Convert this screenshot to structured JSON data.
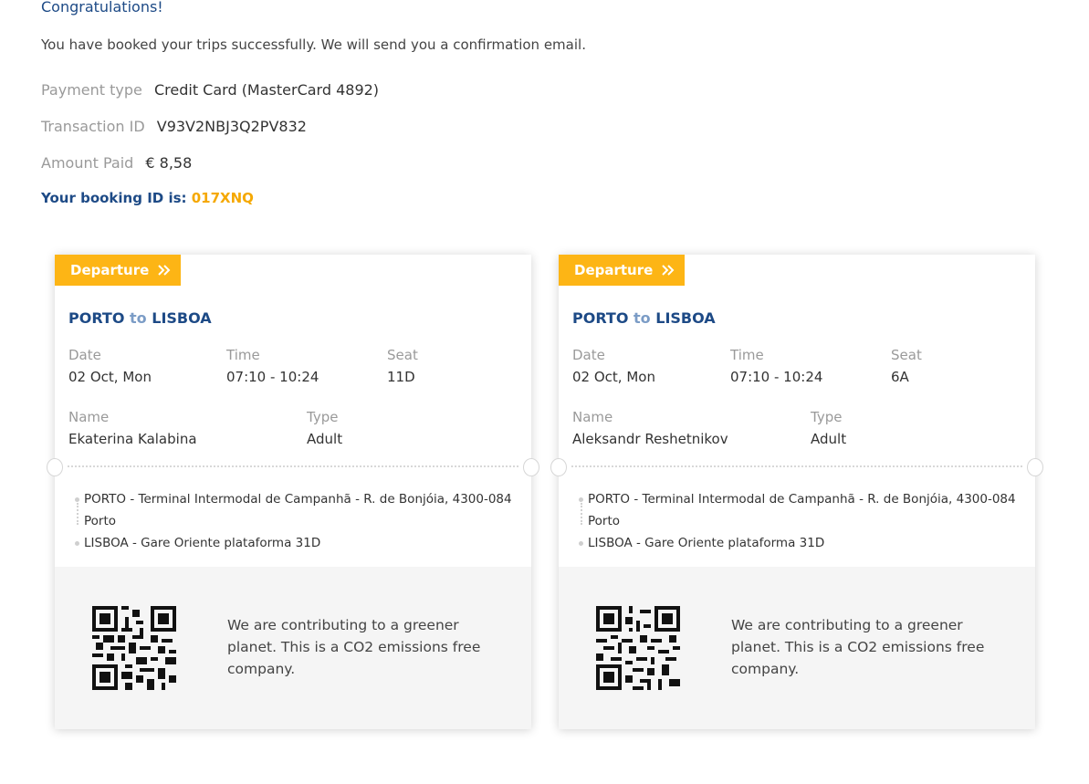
{
  "header": {
    "congrats": "Congratulations!",
    "message": "You have booked your trips successfully. We will send you a confirmation email.",
    "payment_type_label": "Payment type",
    "payment_type_value": "Credit Card (MasterCard 4892)",
    "transaction_label": "Transaction ID",
    "transaction_value": "V93V2NBJ3Q2PV832",
    "amount_label": "Amount Paid",
    "amount_value": "€ 8,58",
    "booking_prefix": "Your booking ID is:",
    "booking_id": "017XNQ"
  },
  "tickets": [
    {
      "badge": "Departure",
      "from": "PORTO",
      "to_word": "to",
      "to": "LISBOA",
      "date_label": "Date",
      "date": "02 Oct, Mon",
      "time_label": "Time",
      "time": "07:10 - 10:24",
      "seat_label": "Seat",
      "seat": "11D",
      "name_label": "Name",
      "name": "Ekaterina Kalabina",
      "type_label": "Type",
      "type": "Adult",
      "origin_stop": "PORTO - Terminal Intermodal de Campanhã - R. de Bonjóia, 4300-084 Porto",
      "dest_stop": "LISBOA - Gare Oriente plataforma 31D",
      "green_text": "We are contributing to a greener planet. This is a CO2 emissions free company."
    },
    {
      "badge": "Departure",
      "from": "PORTO",
      "to_word": "to",
      "to": "LISBOA",
      "date_label": "Date",
      "date": "02 Oct, Mon",
      "time_label": "Time",
      "time": "07:10 - 10:24",
      "seat_label": "Seat",
      "seat": "6A",
      "name_label": "Name",
      "name": "Aleksandr Reshetnikov",
      "type_label": "Type",
      "type": "Adult",
      "origin_stop": "PORTO - Terminal Intermodal de Campanhã - R. de Bonjóia, 4300-084 Porto",
      "dest_stop": "LISBOA - Gare Oriente plataforma 31D",
      "green_text": "We are contributing to a greener planet. This is a CO2 emissions free company."
    }
  ],
  "colors": {
    "navy": "#1d4a86",
    "accent": "#fdb515",
    "booking_id": "#f5a800"
  }
}
